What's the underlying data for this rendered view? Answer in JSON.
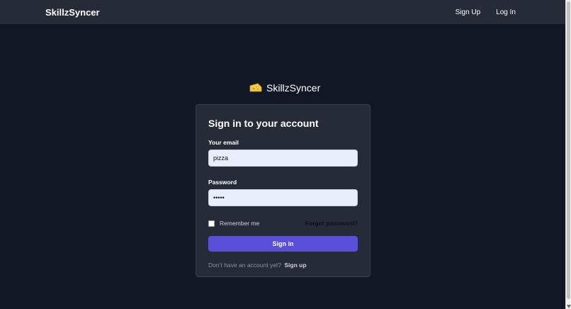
{
  "navbar": {
    "brand": "SkillzSyncer",
    "links": [
      {
        "label": "Sign Up"
      },
      {
        "label": "Log In"
      }
    ]
  },
  "logo": {
    "text": "SkillzSyncer",
    "icon": "cheese-icon",
    "icon_color": "#f2c94c"
  },
  "form": {
    "title": "Sign in to your account",
    "email": {
      "label": "Your email",
      "value": "pizza"
    },
    "password": {
      "label": "Password",
      "value": "•••••"
    },
    "remember_label": "Remember me",
    "remember_checked": false,
    "forgot_label": "Forgot password?",
    "submit_label": "Sign in",
    "no_account_text": "Don’t have an account yet?",
    "signup_label": "Sign up"
  },
  "colors": {
    "background": "#121726",
    "surface": "#262b38",
    "accent": "#5a4fd9",
    "input_bg": "#e8eefc"
  }
}
